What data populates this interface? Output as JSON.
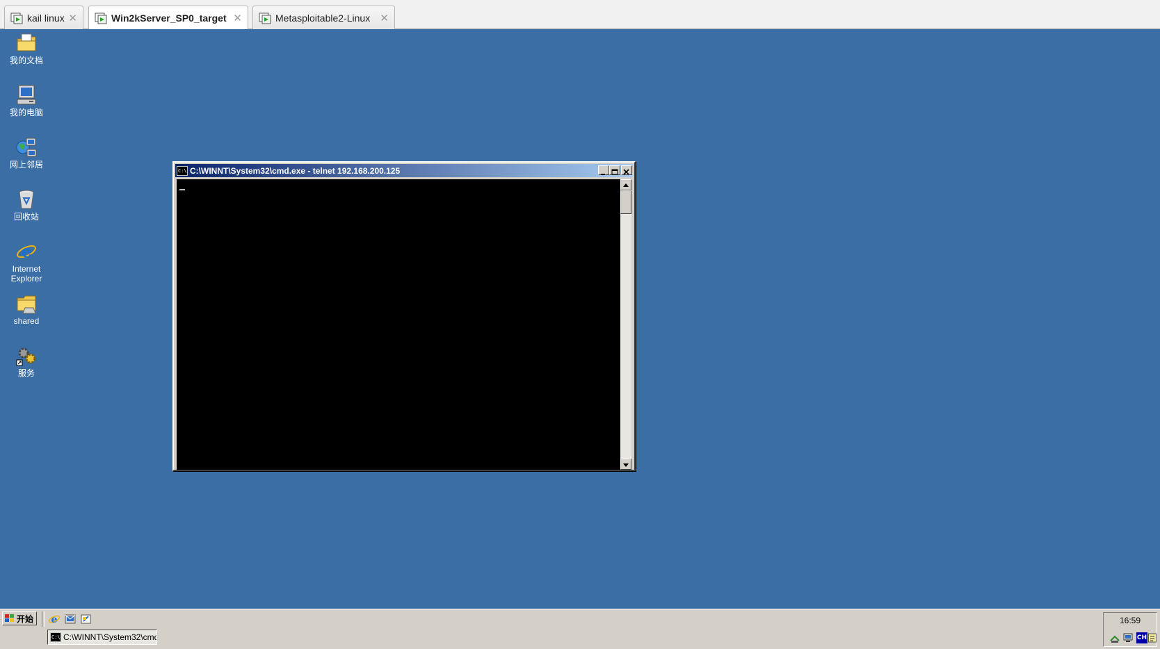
{
  "vm_tabs": [
    {
      "label": "kail linux",
      "active": false
    },
    {
      "label": "Win2kServer_SP0_target",
      "active": true
    },
    {
      "label": "Metasploitable2-Linux",
      "active": false
    }
  ],
  "desktop": {
    "icons": [
      {
        "label": "我的文档",
        "icon": "my-documents-icon"
      },
      {
        "label": "我的电脑",
        "icon": "my-computer-icon"
      },
      {
        "label": "网上邻居",
        "icon": "network-places-icon"
      },
      {
        "label": "回收站",
        "icon": "recycle-bin-icon"
      },
      {
        "label_line1": "Internet",
        "label_line2": "Explorer",
        "icon": "internet-explorer-icon"
      },
      {
        "label": "shared",
        "icon": "folder-icon"
      },
      {
        "label": "服务",
        "icon": "services-icon"
      }
    ]
  },
  "cmd_window": {
    "title": "C:\\WINNT\\System32\\cmd.exe - telnet 192.168.200.125"
  },
  "taskbar": {
    "start_label": "开始",
    "task_label": "C:\\WINNT\\System32\\cmd...",
    "clock": "16:59",
    "ime_label": "CH"
  },
  "colors": {
    "desktop": "#3a6ea5",
    "titlebar_start": "#0a246a",
    "titlebar_end": "#a6caf0",
    "taskbar": "#d4d0c8",
    "console": "#000000"
  }
}
